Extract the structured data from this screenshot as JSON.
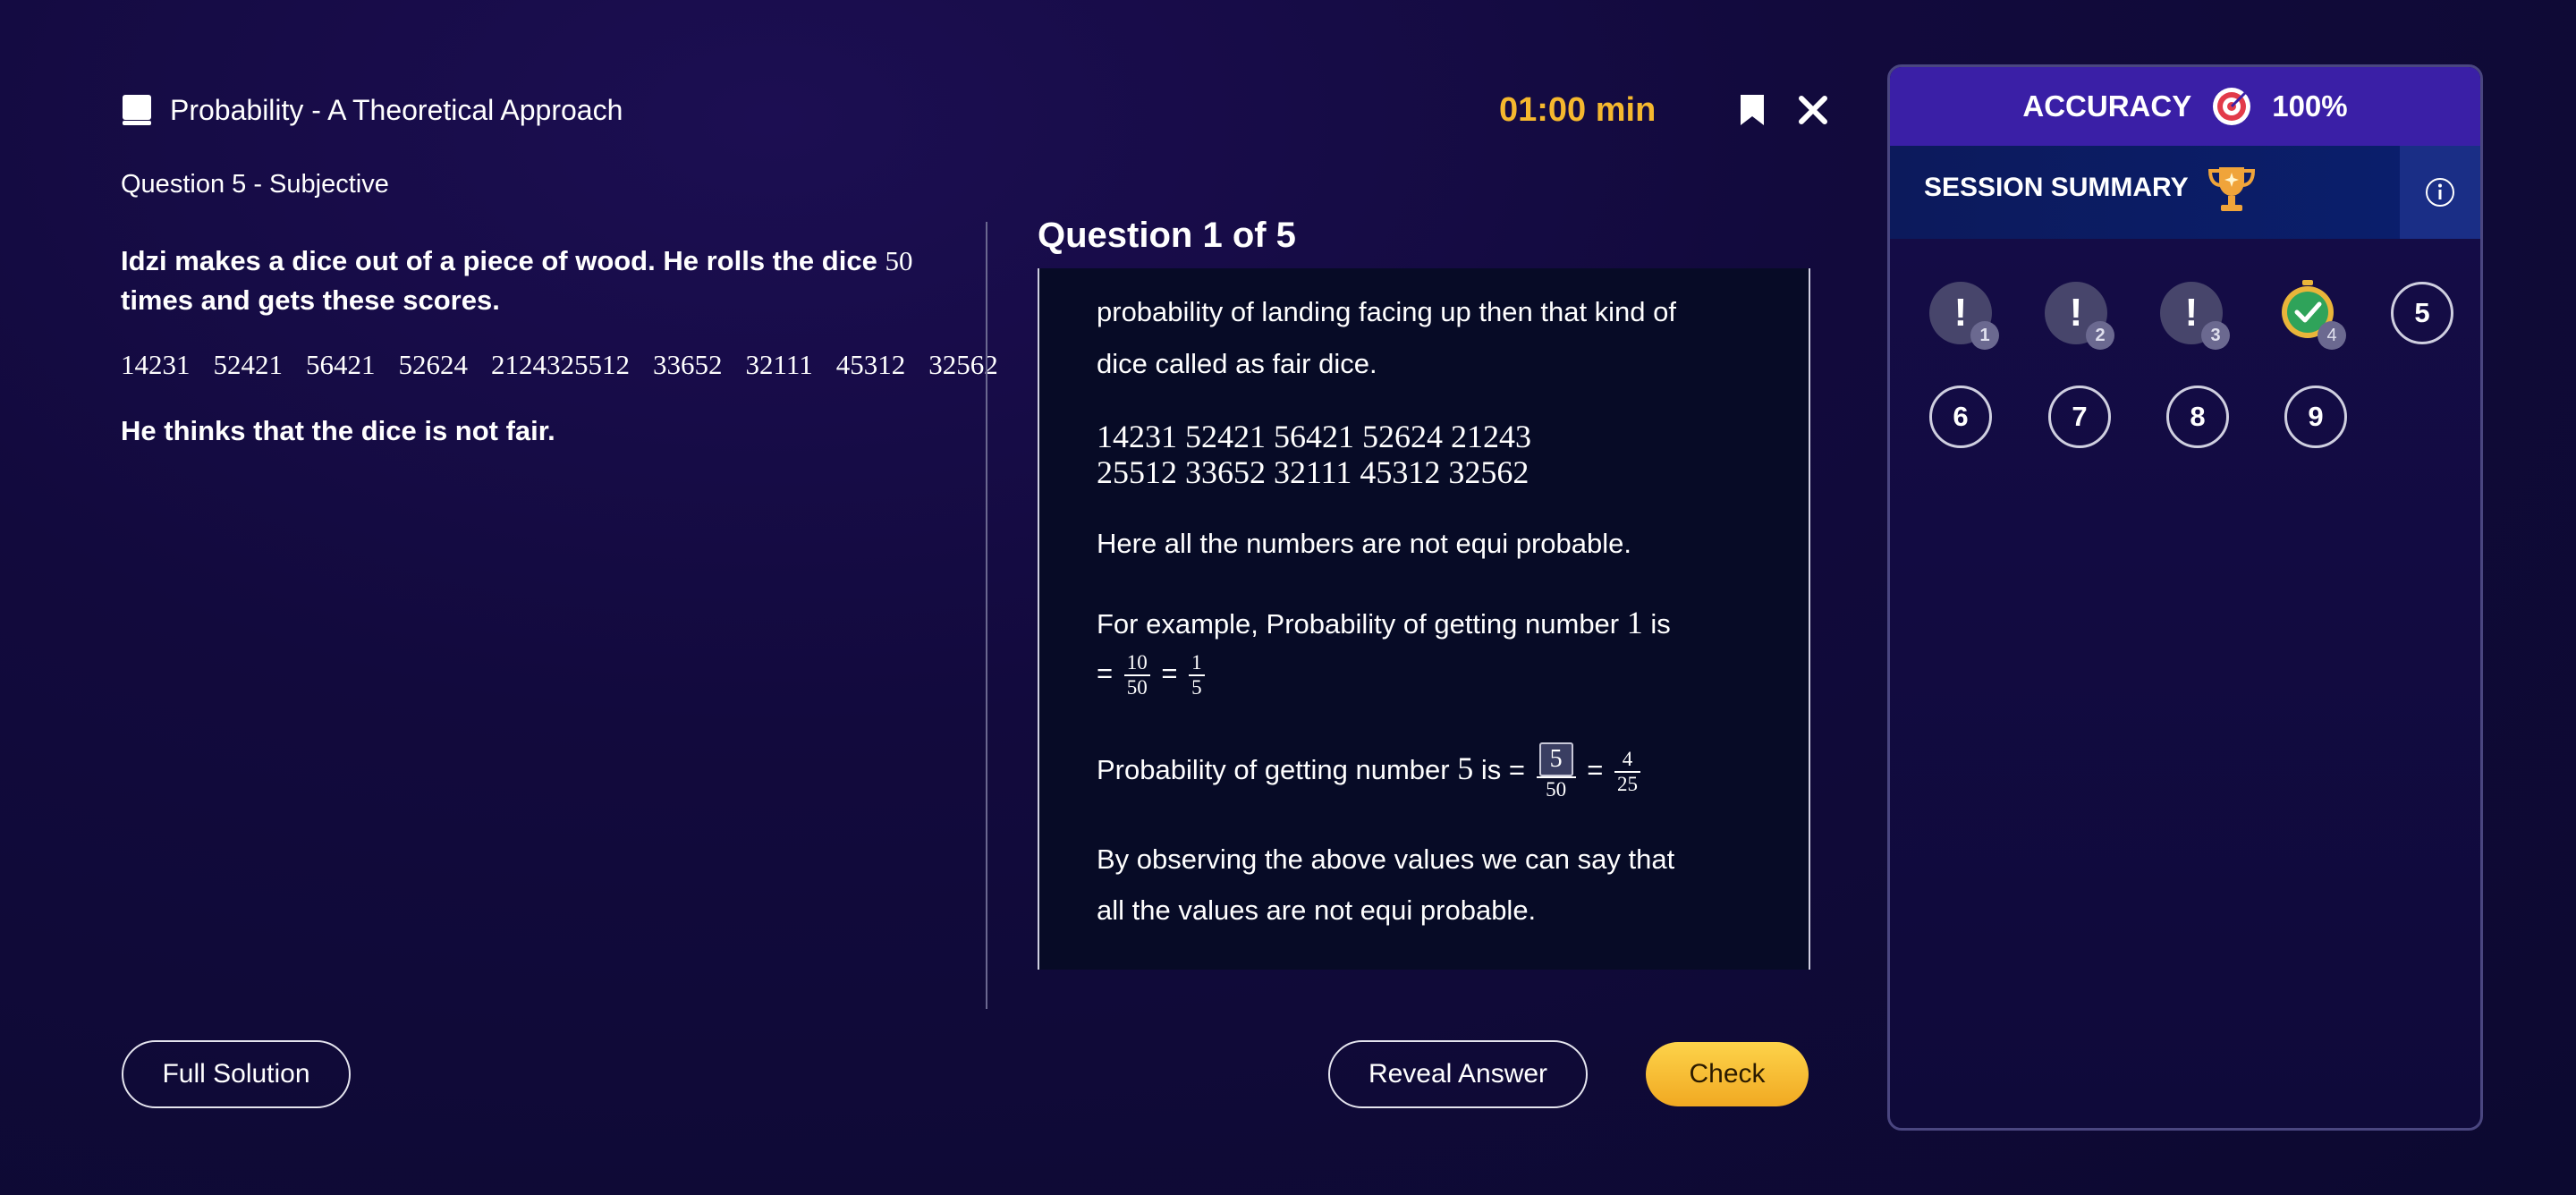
{
  "header": {
    "title": "Probability - A Theoretical Approach",
    "subtitle": "Question 5 - Subjective",
    "timer": "01:00 min"
  },
  "question": {
    "line1": "Idzi makes a dice out of a piece of wood. He rolls the dice",
    "roll_count": "50",
    "line2": " times and gets these scores.",
    "scores": [
      "14231",
      "52421",
      "56421",
      "52624",
      "2124325512",
      "33652",
      "32111",
      "45312",
      "32562"
    ],
    "statement": "He thinks that the dice is not fair."
  },
  "solution": {
    "counter": "Question 1 of 5",
    "p1": "probability of landing facing up then that kind of",
    "p2": "dice called as fair dice.",
    "scores_row1": "14231 52421 56421 52624 21243",
    "scores_row2": "25512 33652 32111 45312 32562",
    "p3": "Here all the numbers are not equi probable.",
    "p4_prefix": "For example, Probability of getting number",
    "p4_num": "1",
    "p4_suffix": "is",
    "eq": "=",
    "f1_num": "10",
    "f1_den": "50",
    "f2_num": "1",
    "f2_den": "5",
    "p5_prefix": "Probability of getting number",
    "p5_num": "5",
    "p5_suffix": "is =",
    "f3_num": "5",
    "f3_den": "50",
    "f4_num": "4",
    "f4_den": "25",
    "p6": "By observing the above values we can say that",
    "p7": "all the values are not equi probable."
  },
  "buttons": {
    "full_solution": "Full Solution",
    "reveal_answer": "Reveal Answer",
    "check": "Check"
  },
  "sidebar": {
    "accuracy_label": "ACCURACY",
    "accuracy_value": "100%",
    "session_summary": "SESSION SUMMARY",
    "exclaim": "!",
    "questions": [
      {
        "label": "1",
        "state": "attempted"
      },
      {
        "label": "2",
        "state": "attempted"
      },
      {
        "label": "3",
        "state": "attempted"
      },
      {
        "label": "4",
        "state": "timed-correct"
      },
      {
        "label": "5",
        "state": "current"
      },
      {
        "label": "6",
        "state": "unattempted"
      },
      {
        "label": "7",
        "state": "unattempted"
      },
      {
        "label": "8",
        "state": "unattempted"
      },
      {
        "label": "9",
        "state": "unattempted"
      }
    ]
  },
  "colors": {
    "timer": "#f5b82e",
    "check_button": "#f8c23a",
    "accuracy_bar": "#3a1fa6",
    "summary_bar": "#0c1a5c"
  },
  "icons": [
    "book-icon",
    "bookmark-icon",
    "close-icon",
    "target-icon",
    "trophy-icon",
    "info-icon",
    "stopwatch-check-icon"
  ]
}
